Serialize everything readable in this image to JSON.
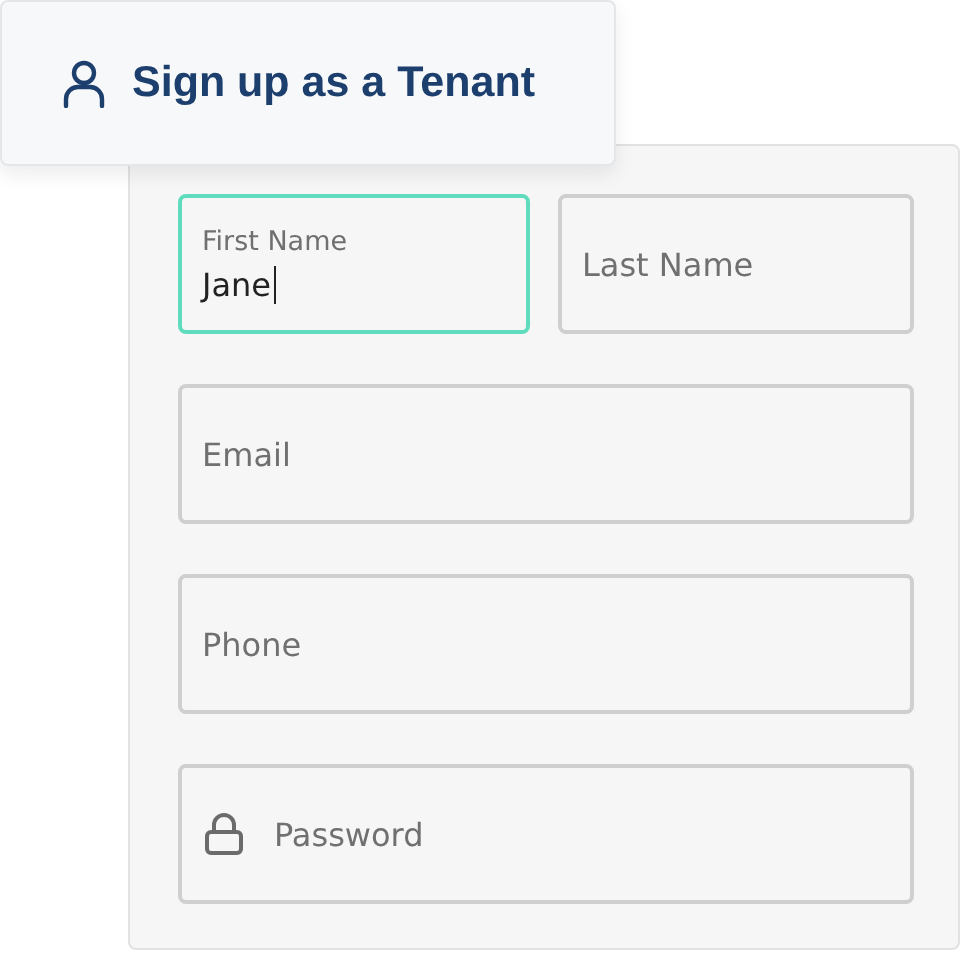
{
  "header": {
    "title": "Sign up as a Tenant"
  },
  "fields": [
    {
      "kind": "text",
      "label": "First Name",
      "value": "Jane",
      "focused": true
    },
    {
      "kind": "text",
      "placeholder": "Last Name",
      "focused": false
    },
    {
      "kind": "text",
      "placeholder": "Email",
      "focused": false
    },
    {
      "kind": "text",
      "placeholder": "Phone",
      "focused": false
    },
    {
      "kind": "password",
      "placeholder": "Password",
      "focused": false
    }
  ]
}
